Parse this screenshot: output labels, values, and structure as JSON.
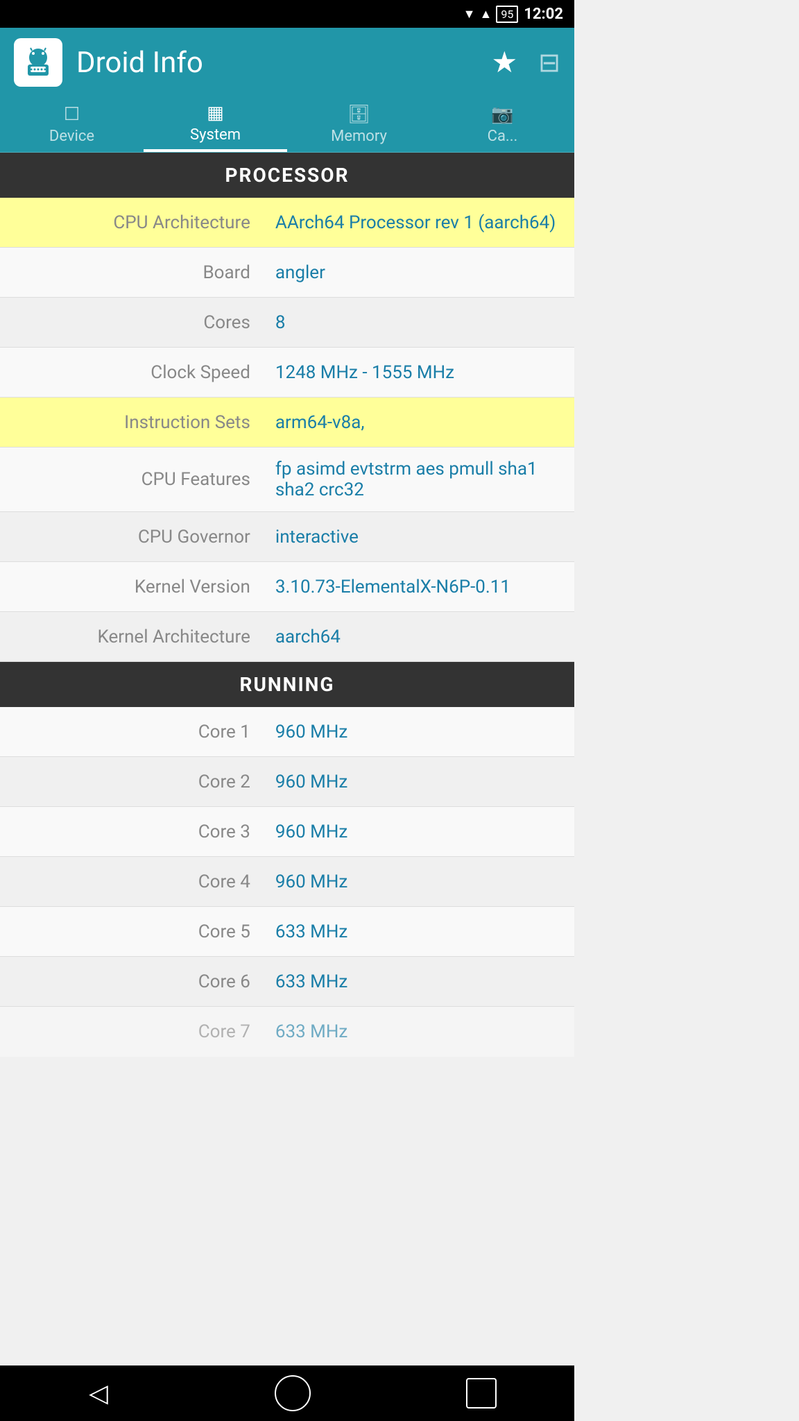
{
  "statusBar": {
    "time": "12:02",
    "battery": "95"
  },
  "appBar": {
    "title": "Droid Info",
    "logoIcon": "⚙",
    "starIcon": "★",
    "settingsIcon": "⚙"
  },
  "tabs": [
    {
      "id": "device",
      "label": "Device",
      "icon": "📱",
      "active": false
    },
    {
      "id": "system",
      "label": "System",
      "icon": "💾",
      "active": true
    },
    {
      "id": "memory",
      "label": "Memory",
      "icon": "🗄",
      "active": false
    },
    {
      "id": "camera",
      "label": "Ca...",
      "icon": "📷",
      "active": false
    }
  ],
  "sections": [
    {
      "header": "PROCESSOR",
      "rows": [
        {
          "label": "CPU Architecture",
          "value": "AArch64 Processor rev 1 (aarch64)",
          "highlighted": true
        },
        {
          "label": "Board",
          "value": "angler",
          "highlighted": false
        },
        {
          "label": "Cores",
          "value": "8",
          "highlighted": false
        },
        {
          "label": "Clock Speed",
          "value": "1248 MHz - 1555 MHz",
          "highlighted": false
        },
        {
          "label": "Instruction Sets",
          "value": "arm64-v8a,",
          "highlighted": true
        },
        {
          "label": "CPU Features",
          "value": "fp asimd evtstrm aes pmull sha1 sha2 crc32",
          "highlighted": false
        },
        {
          "label": "CPU Governor",
          "value": "interactive",
          "highlighted": false
        },
        {
          "label": "Kernel Version",
          "value": "3.10.73-ElementalX-N6P-0.11",
          "highlighted": false
        },
        {
          "label": "Kernel Architecture",
          "value": "aarch64",
          "highlighted": false
        }
      ]
    },
    {
      "header": "RUNNING",
      "rows": [
        {
          "label": "Core 1",
          "value": "960 MHz",
          "highlighted": false
        },
        {
          "label": "Core 2",
          "value": "960 MHz",
          "highlighted": false
        },
        {
          "label": "Core 3",
          "value": "960 MHz",
          "highlighted": false
        },
        {
          "label": "Core 4",
          "value": "960 MHz",
          "highlighted": false
        },
        {
          "label": "Core 5",
          "value": "633 MHz",
          "highlighted": false
        },
        {
          "label": "Core 6",
          "value": "633 MHz",
          "highlighted": false
        },
        {
          "label": "Core 7",
          "value": "633 MHz",
          "highlighted": false
        }
      ]
    }
  ],
  "bottomNav": {
    "backIcon": "◁",
    "homeIcon": "○",
    "recentIcon": "□"
  }
}
